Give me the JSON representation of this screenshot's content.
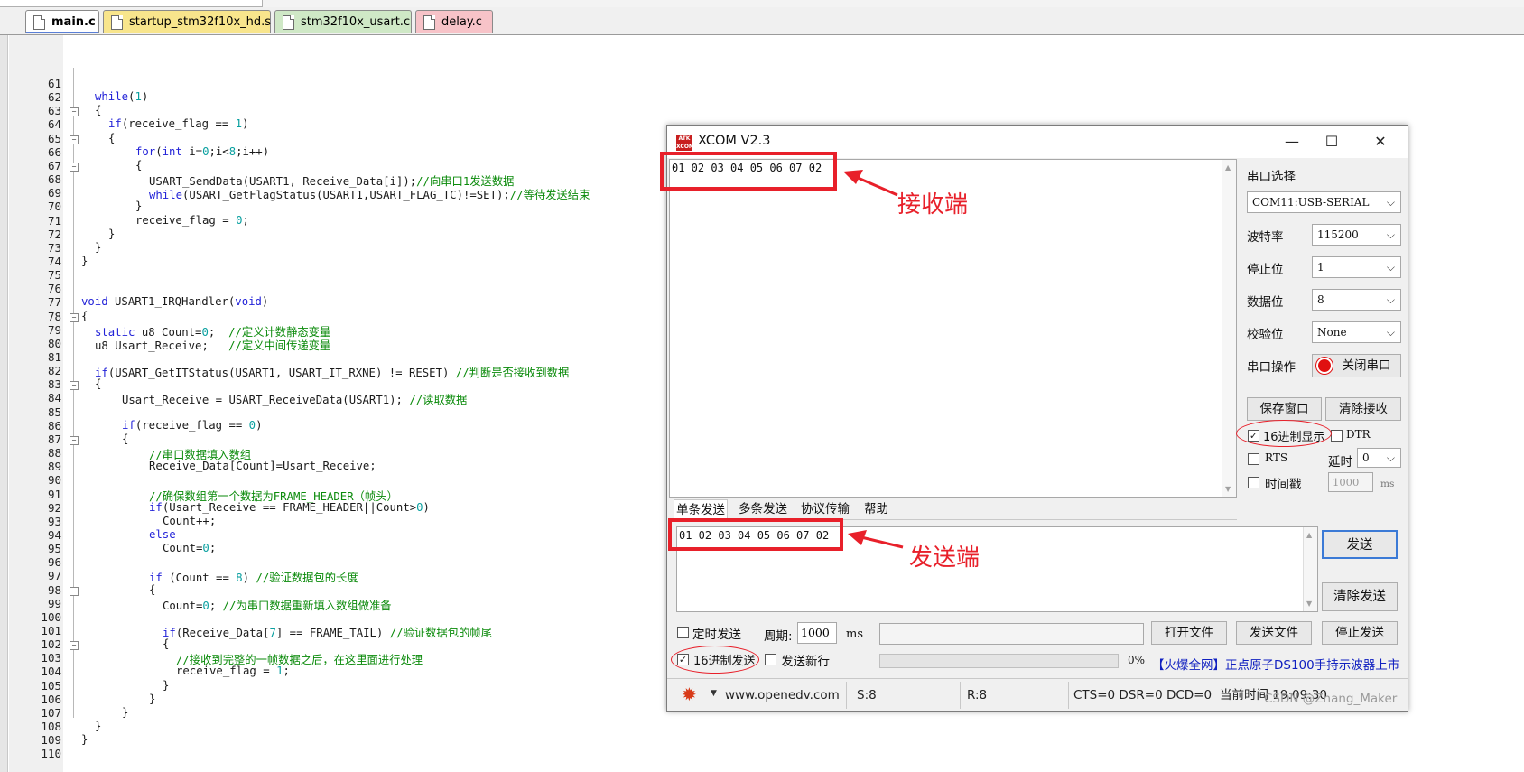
{
  "editor": {
    "tabs": [
      {
        "label": "main.c"
      },
      {
        "label": "startup_stm32f10x_hd.s"
      },
      {
        "label": "stm32f10x_usart.c"
      },
      {
        "label": "delay.c"
      }
    ],
    "lines": [
      {
        "n": "61",
        "text": ""
      },
      {
        "n": "62",
        "text": "while(1)"
      },
      {
        "n": "63",
        "text": "{"
      },
      {
        "n": "64",
        "text": "if(receive_flag == 1)"
      },
      {
        "n": "65",
        "text": "{"
      },
      {
        "n": "66",
        "text": "for(int i=0;i<8;i++)"
      },
      {
        "n": "67",
        "text": "{"
      },
      {
        "n": "68",
        "text": "USART_SendData(USART1, Receive_Data[i]);//向串口1发送数据"
      },
      {
        "n": "69",
        "text": "while(USART_GetFlagStatus(USART1,USART_FLAG_TC)!=SET);//等待发送结束"
      },
      {
        "n": "70",
        "text": "}"
      },
      {
        "n": "71",
        "text": "receive_flag = 0;"
      },
      {
        "n": "72",
        "text": "}"
      },
      {
        "n": "73",
        "text": "}"
      },
      {
        "n": "74",
        "text": "}"
      },
      {
        "n": "75",
        "text": ""
      },
      {
        "n": "76",
        "text": ""
      },
      {
        "n": "77",
        "text": "void USART1_IRQHandler(void)"
      },
      {
        "n": "78",
        "text": "{"
      },
      {
        "n": "79",
        "text": "static u8 Count=0;  //定义计数静态变量"
      },
      {
        "n": "80",
        "text": "u8 Usart_Receive;   //定义中间传递变量"
      },
      {
        "n": "81",
        "text": ""
      },
      {
        "n": "82",
        "text": "if(USART_GetITStatus(USART1, USART_IT_RXNE) != RESET) //判断是否接收到数据"
      },
      {
        "n": "83",
        "text": "{"
      },
      {
        "n": "84",
        "text": "Usart_Receive = USART_ReceiveData(USART1); //读取数据"
      },
      {
        "n": "85",
        "text": ""
      },
      {
        "n": "86",
        "text": "if(receive_flag == 0)"
      },
      {
        "n": "87",
        "text": "{"
      },
      {
        "n": "88",
        "text": "//串口数据填入数组"
      },
      {
        "n": "89",
        "text": "Receive_Data[Count]=Usart_Receive;"
      },
      {
        "n": "90",
        "text": ""
      },
      {
        "n": "91",
        "text": "//确保数组第一个数据为FRAME_HEADER（帧头）"
      },
      {
        "n": "92",
        "text": "if(Usart_Receive == FRAME_HEADER||Count>0)"
      },
      {
        "n": "93",
        "text": "Count++;"
      },
      {
        "n": "94",
        "text": "else"
      },
      {
        "n": "95",
        "text": "Count=0;"
      },
      {
        "n": "96",
        "text": ""
      },
      {
        "n": "97",
        "text": "if (Count == 8) //验证数据包的长度"
      },
      {
        "n": "98",
        "text": "{"
      },
      {
        "n": "99",
        "text": "Count=0; //为串口数据重新填入数组做准备"
      },
      {
        "n": "100",
        "text": ""
      },
      {
        "n": "101",
        "text": "if(Receive_Data[7] == FRAME_TAIL) //验证数据包的帧尾"
      },
      {
        "n": "102",
        "text": "{"
      },
      {
        "n": "103",
        "text": "//接收到完整的一帧数据之后，在这里面进行处理"
      },
      {
        "n": "104",
        "text": "receive_flag = 1;"
      },
      {
        "n": "105",
        "text": "}"
      },
      {
        "n": "106",
        "text": "}"
      },
      {
        "n": "107",
        "text": "}"
      },
      {
        "n": "108",
        "text": "}"
      },
      {
        "n": "109",
        "text": "}"
      },
      {
        "n": "110",
        "text": ""
      }
    ]
  },
  "xcom": {
    "title": "XCOM V2.3",
    "logo_text": "ATK XCOM",
    "receive_text": "01 02 03 04 05 06 07 02",
    "send_text": "01 02 03 04 05 06 07 02",
    "settings": {
      "port_label": "串口选择",
      "port_value": "COM11:USB-SERIAL",
      "baud_label": "波特率",
      "baud_value": "115200",
      "stop_label": "停止位",
      "stop_value": "1",
      "data_label": "数据位",
      "data_value": "8",
      "parity_label": "校验位",
      "parity_value": "None",
      "op_label": "串口操作",
      "close_port_label": "关闭串口",
      "save_window_label": "保存窗口",
      "clear_receive_label": "清除接收",
      "hex_display_label": "16进制显示",
      "dtr_label": "DTR",
      "rts_label": "RTS",
      "delay_label": "延时",
      "delay_value": "0",
      "timestamp_label": "时间戳",
      "timestamp_value": "1000",
      "timestamp_unit": "ms"
    },
    "send_tabs": [
      "单条发送",
      "多条发送",
      "协议传输",
      "帮助"
    ],
    "send_button": "发送",
    "clear_send_button": "清除发送",
    "timed_send_label": "定时发送",
    "period_label": "周期:",
    "period_value": "1000",
    "period_unit": "ms",
    "open_file_button": "打开文件",
    "send_file_button": "发送文件",
    "stop_send_button": "停止发送",
    "hex_send_label": "16进制发送",
    "send_newline_label": "发送新行",
    "progress_text": "0%",
    "progress_fraction": 0,
    "ad_text": "【火爆全网】正点原子DS100手持示波器上市",
    "status": {
      "website": "www.openedv.com",
      "sent": "S:8",
      "received": "R:8",
      "lines": "CTS=0 DSR=0 DCD=0",
      "time": "当前时间 19:09:30"
    },
    "checked": {
      "hex_display": true,
      "hex_send": true,
      "timed_send": false,
      "send_newline": false,
      "dtr": false,
      "rts": false,
      "timestamp": false
    },
    "colors": {
      "annotation": "#e8202a",
      "ad_link": "#1020c0"
    }
  },
  "annotations": {
    "receive_label": "接收端",
    "send_label": "发送端"
  },
  "watermark": "CSDN @Zhang_Maker"
}
